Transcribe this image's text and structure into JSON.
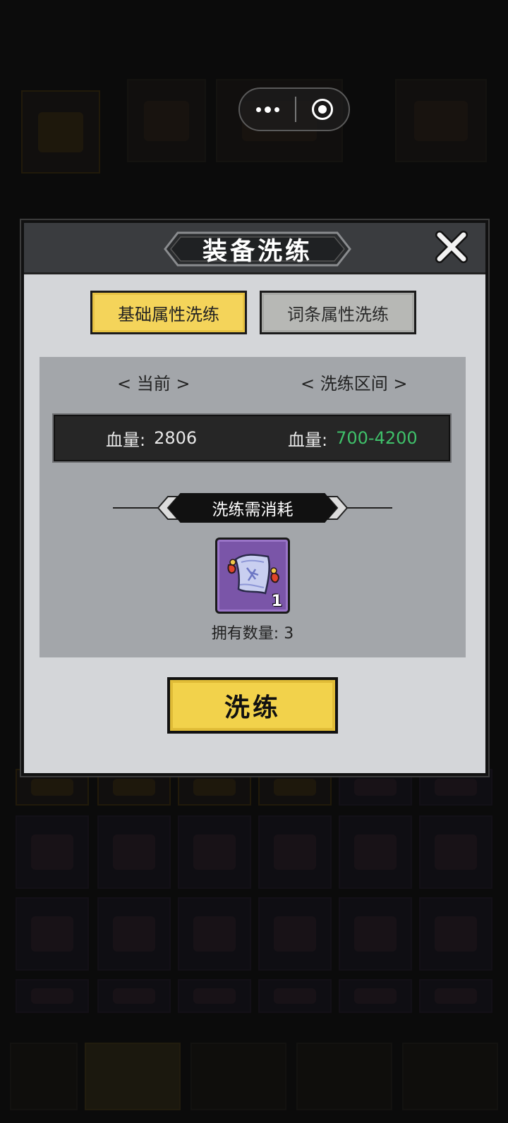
{
  "dialog": {
    "title": "装备洗练",
    "tabs": [
      {
        "label": "基础属性洗练",
        "active": true
      },
      {
        "label": "词条属性洗练",
        "active": false
      }
    ],
    "columns": {
      "current": "< 当前 >",
      "range": "< 洗练区间 >"
    },
    "stats": {
      "current_label": "血量:",
      "current_value": "2806",
      "range_label": "血量:",
      "range_value": "700-4200"
    },
    "cost": {
      "heading": "洗练需消耗",
      "item_icon": "scroll-icon",
      "item_count": "1",
      "owned_text": "拥有数量: 3"
    },
    "action_label": "洗练"
  },
  "colors": {
    "accent_yellow": "#f4d45a",
    "range_green": "#3fc06a",
    "item_rarity_purple": "#7a55a8"
  }
}
